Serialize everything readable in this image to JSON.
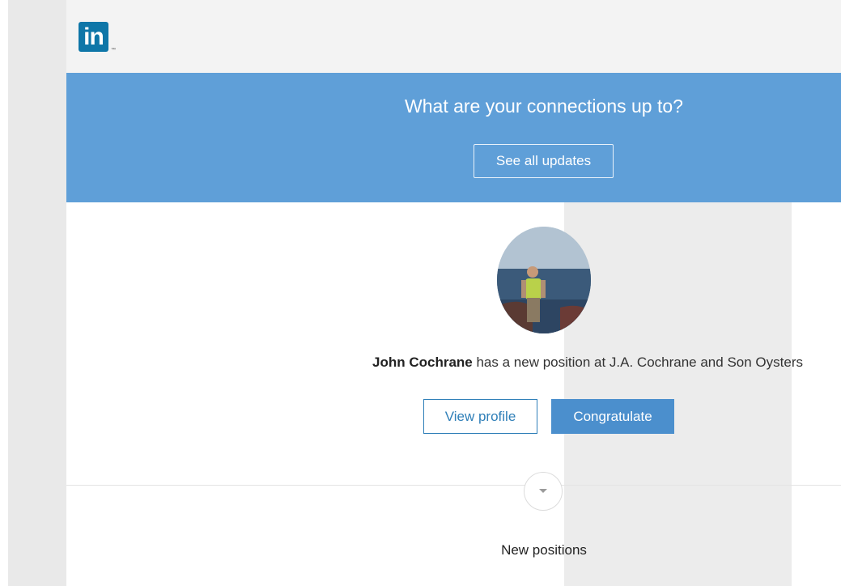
{
  "app": {
    "logo_text": "in",
    "logo_tm": "™"
  },
  "banner": {
    "title": "What are your connections up to?",
    "button_label": "See all updates"
  },
  "update": {
    "person_name": "John Cochrane",
    "message": " has a new position at J.A. Cochrane and Son Oysters",
    "view_profile_label": "View profile",
    "congratulate_label": "Congratulate"
  },
  "section": {
    "label": "New positions"
  },
  "colors": {
    "brand": "#0e76a8",
    "banner": "#5f9fd8",
    "primary_button": "#4b8fcd"
  }
}
